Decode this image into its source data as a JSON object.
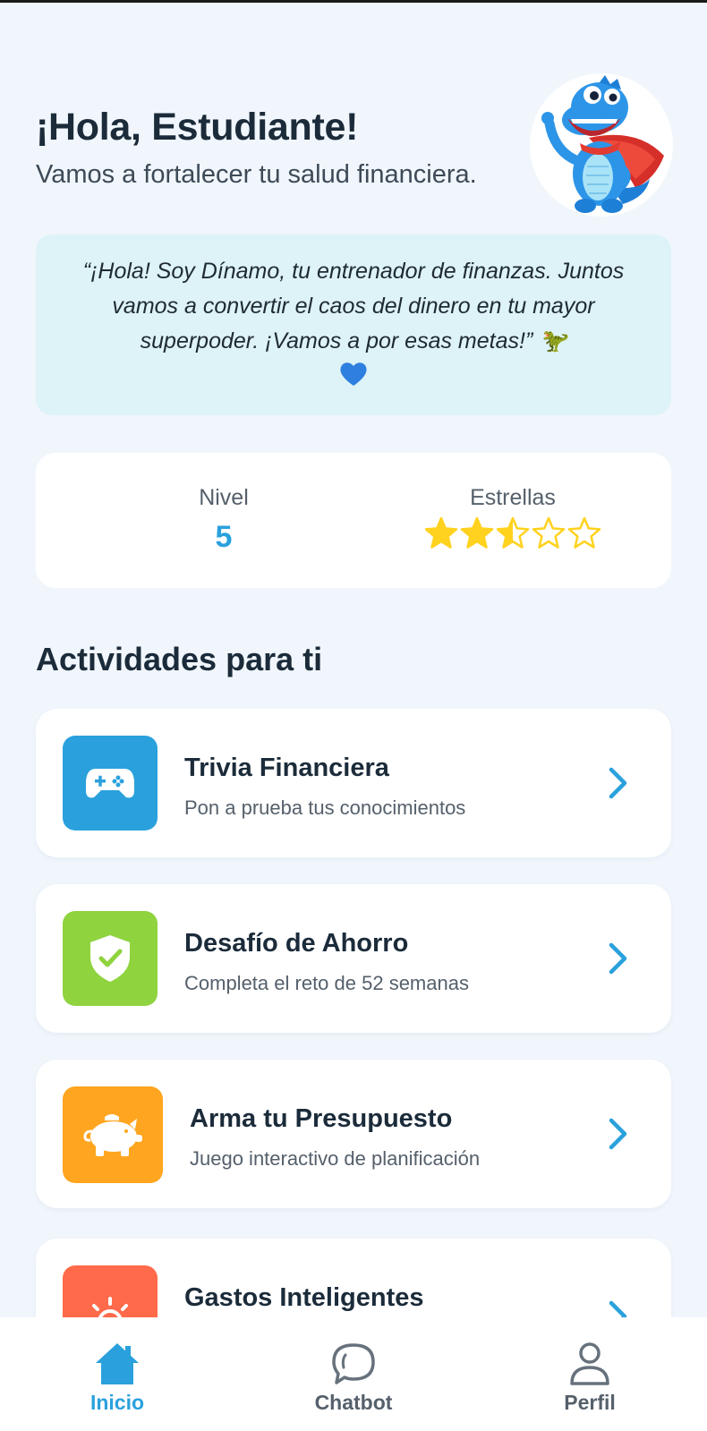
{
  "header": {
    "greeting": "¡Hola, Estudiante!",
    "subtitle": "Vamos a fortalecer tu salud financiera."
  },
  "mascot": {
    "icon": "dinosaur-mascot-avatar"
  },
  "quote": {
    "text": "“¡Hola! Soy Dínamo, tu entrenador de finanzas. Juntos vamos a convertir el caos del dinero en tu mayor superpoder. ¡Vamos a por esas metas!” 🦖",
    "heart_icon": "blue-heart-icon"
  },
  "stats": {
    "level_label": "Nivel",
    "level_value": "5",
    "stars_label": "Estrellas",
    "stars_rating": 2.5,
    "stars_max": 5
  },
  "section_title": "Actividades para ti",
  "activities": [
    {
      "title": "Trivia Financiera",
      "subtitle": "Pon a prueba tus conocimientos",
      "icon": "gamepad-icon",
      "color": "#2aa1dd"
    },
    {
      "title": "Desafío de Ahorro",
      "subtitle": "Completa el reto de 52 semanas",
      "icon": "shield-check-icon",
      "color": "#8fd33f"
    },
    {
      "title": "Arma tu Presupuesto",
      "subtitle": "Juego interactivo de planificación",
      "icon": "piggy-bank-icon",
      "color": "#ffa51f"
    },
    {
      "title": "Gastos Inteligentes",
      "subtitle": "",
      "icon": "lightbulb-icon",
      "color": "#ff6a4a"
    }
  ],
  "nav": [
    {
      "label": "Inicio",
      "icon": "home-icon",
      "active": true
    },
    {
      "label": "Chatbot",
      "icon": "chat-bubble-icon",
      "active": false
    },
    {
      "label": "Perfil",
      "icon": "user-icon",
      "active": false
    }
  ],
  "colors": {
    "accent": "#2aa1dd",
    "background": "#f0f6fc",
    "quote_bg": "#def3f7",
    "star": "#ffd21f"
  }
}
